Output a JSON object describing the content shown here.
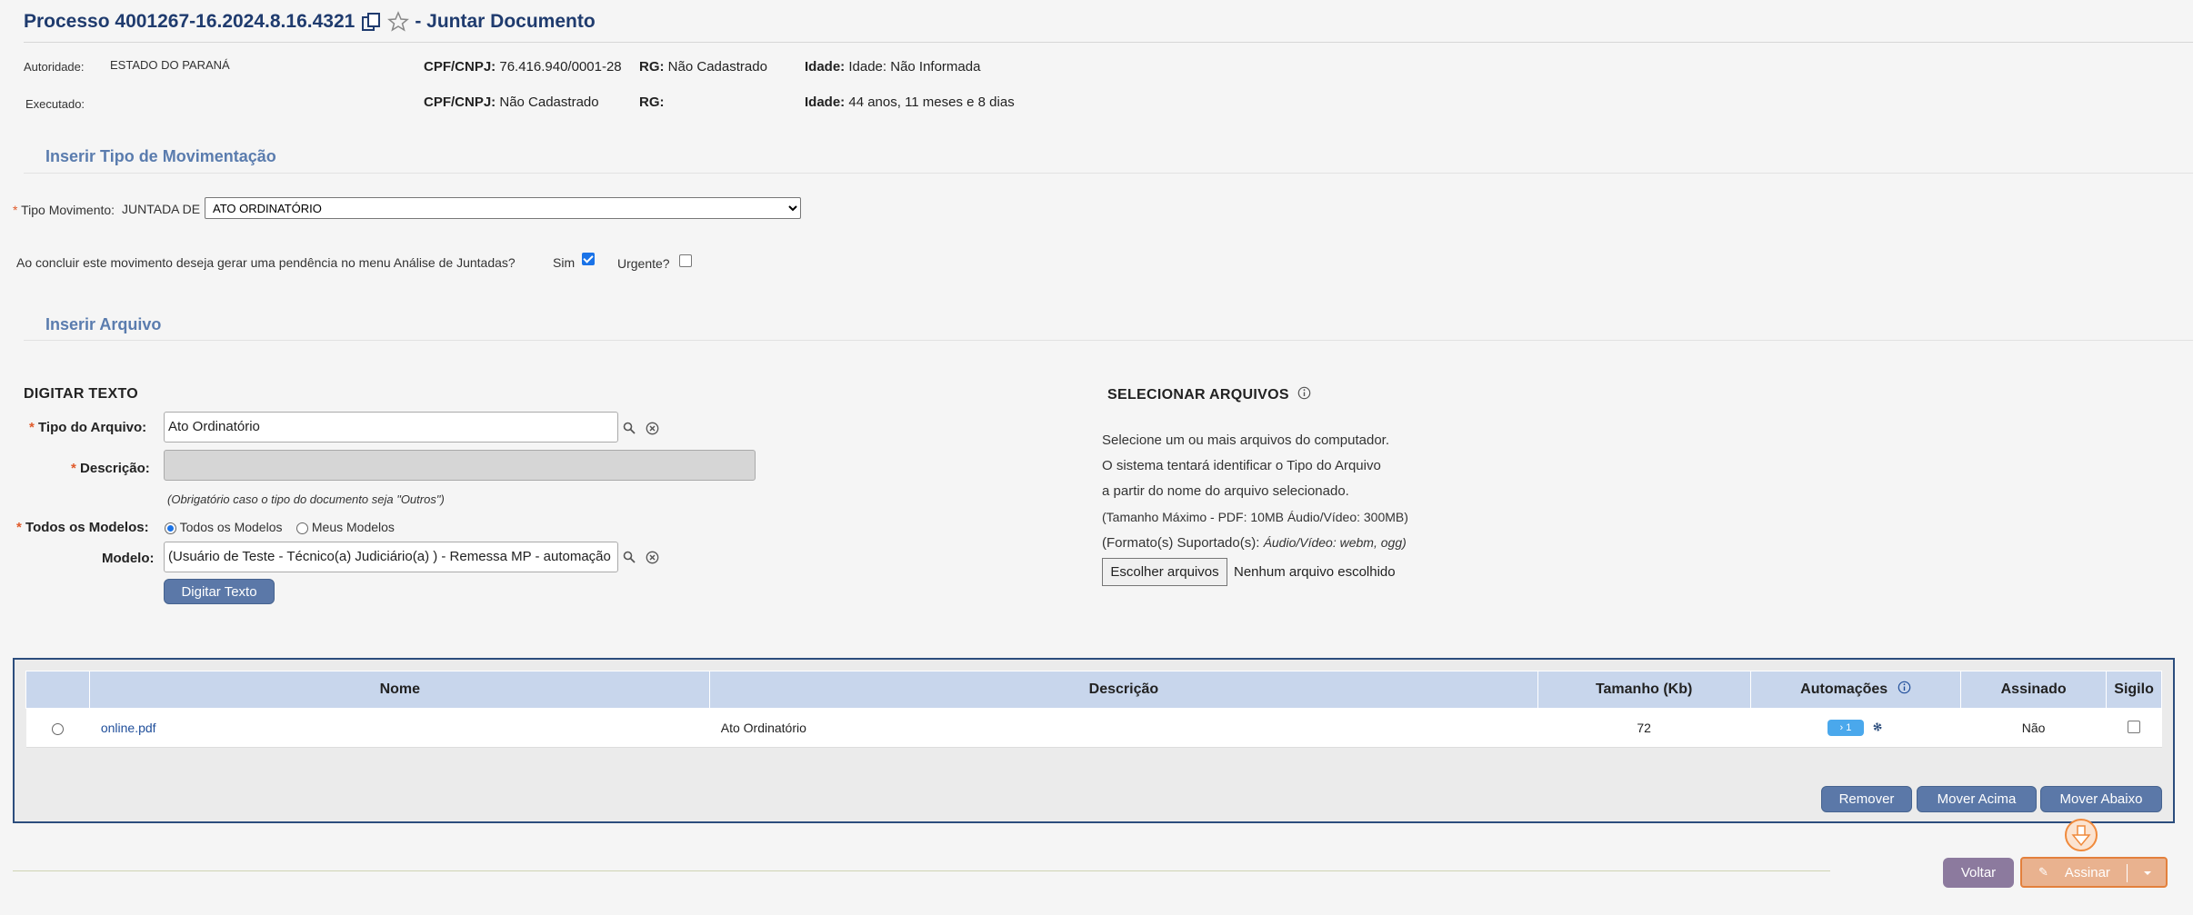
{
  "header": {
    "title": "Processo 4001267-16.2024.8.16.4321",
    "subtitle": "- Juntar Documento"
  },
  "parties": {
    "autoridade_label": "Autoridade:",
    "autoridade_value": "ESTADO DO PARANÁ",
    "cpf1_label": "CPF/CNPJ:",
    "cpf1_value": "76.416.940/0001-28",
    "rg1_label": "RG:",
    "rg1_value": "Não Cadastrado",
    "idade1_label": "Idade:",
    "idade1_value": "Idade: Não Informada",
    "executado_label": "Executado:",
    "cpf2_label": "CPF/CNPJ:",
    "cpf2_value": "Não Cadastrado",
    "rg2_label": "RG:",
    "idade2_label": "Idade:",
    "idade2_value": "44 anos, 11 meses e 8 dias"
  },
  "movimentacao": {
    "section_title": "Inserir Tipo de Movimentação",
    "tipo_label": "Tipo Movimento:",
    "juntada_prefix": "JUNTADA DE",
    "selected": "ATO ORDINATÓRIO",
    "pendencia_question": "Ao concluir este movimento deseja gerar uma pendência no menu Análise de Juntadas?",
    "sim_label": "Sim",
    "urgente_label": "Urgente?"
  },
  "arquivo": {
    "section_title": "Inserir Arquivo",
    "digitar_heading": "DIGITAR TEXTO",
    "tipo_arquivo_label": "Tipo do Arquivo:",
    "tipo_arquivo_value": "Ato Ordinatório",
    "descricao_label": "Descrição:",
    "obrigatorio_hint": "(Obrigatório caso o tipo do documento seja \"Outros\")",
    "todos_modelos_label": "Todos os Modelos:",
    "radio_todos": "Todos os Modelos",
    "radio_meus": "Meus Modelos",
    "modelo_label": "Modelo:",
    "modelo_value": "(Usuário de Teste - Técnico(a) Judiciário(a) ) - Remessa MP - automação",
    "digitar_button": "Digitar Texto",
    "selecionar_heading": "SELECIONAR ARQUIVOS",
    "help_line1": "Selecione um ou mais arquivos do computador.",
    "help_line2": "O sistema tentará identificar o Tipo do Arquivo",
    "help_line3": "a partir do nome do arquivo selecionado.",
    "help_line4": "(Tamanho Máximo - PDF: 10MB  Áudio/Vídeo: 300MB)",
    "help_line5_prefix": "(Formato(s) Suportado(s):",
    "help_line5_italic": "Áudio/Vídeo: webm, ogg)",
    "choose_button": "Escolher arquivos",
    "no_file": "Nenhum arquivo escolhido"
  },
  "table": {
    "headers": [
      "",
      "Nome",
      "Descrição",
      "Tamanho (Kb)",
      "Automações",
      "Assinado",
      "Sigilo"
    ],
    "rows": [
      {
        "nome": "online.pdf",
        "descricao": "Ato Ordinatório",
        "tamanho": "72",
        "automacoes": "1",
        "assinado": "Não"
      }
    ],
    "remover": "Remover",
    "mover_acima": "Mover Acima",
    "mover_abaixo": "Mover Abaixo"
  },
  "footer": {
    "voltar": "Voltar",
    "assinar": "Assinar"
  },
  "colors": {
    "title": "#1f3b6e",
    "section": "#5a7cae",
    "button_blue": "#5b78a8",
    "table_header": "#c8d6ec",
    "assinar_border": "#e3803c"
  }
}
